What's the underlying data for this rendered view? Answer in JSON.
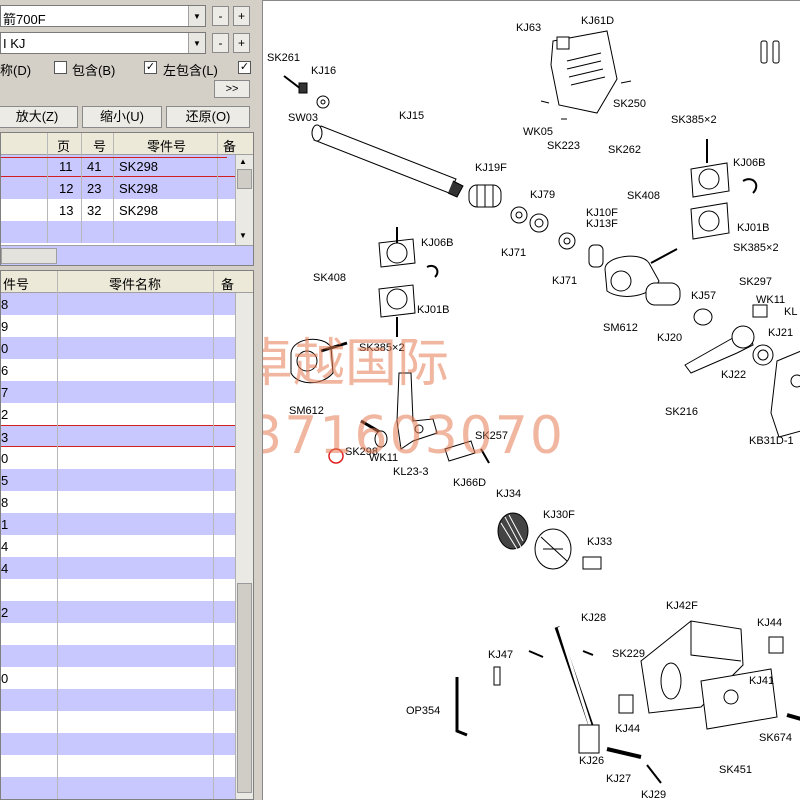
{
  "toolbar": {
    "combo1": "箭700F",
    "combo2": "I KJ",
    "minus": "-",
    "plus": "+",
    "dropdown_glyph": "▼",
    "check1_label": "称(D)",
    "check2_label": "包含(B)",
    "check3_label": "左包含(L)",
    "check2_checked": false,
    "check3_checked": true,
    "check4_checked": true,
    "nav_label": ">>",
    "zoom_in": "放大(Z)",
    "zoom_out": "缩小(U)",
    "restore": "还原(O)"
  },
  "top_table": {
    "headers": [
      "页",
      "号",
      "零件号",
      "备"
    ],
    "rows": [
      {
        "page": "11",
        "num": "41",
        "part": "SK298",
        "selected": true
      },
      {
        "page": "12",
        "num": "23",
        "part": "SK298",
        "selected": true
      },
      {
        "page": "13",
        "num": "32",
        "part": "SK298",
        "selected": false
      }
    ],
    "scroll_up": "▲",
    "scroll_down": "▼"
  },
  "bottom_table": {
    "headers": [
      "件号",
      "零件名称",
      "备"
    ],
    "row_codes": [
      "8",
      "9",
      "0",
      "6",
      "7",
      "2",
      "3",
      "0",
      "5",
      "8",
      "1",
      "4",
      "4",
      "",
      "2",
      "",
      "",
      "0",
      "",
      "",
      "",
      "",
      ""
    ],
    "selected_row_index": 6
  },
  "diagram": {
    "labels": [
      "SK261",
      "KJ16",
      "SW03",
      "KJ15",
      "KJ63",
      "KJ61D",
      "SK250",
      "WK05",
      "SK223",
      "SK262",
      "SK385×2",
      "KJ06B",
      "KJ19F",
      "KJ79",
      "SK408",
      "KJ01B",
      "SK385×2",
      "KJ10F",
      "KJ13F",
      "KJ71",
      "KJ71",
      "KJ06B",
      "SK408",
      "KJ01B",
      "SK297",
      "WK11",
      "KL",
      "KJ57",
      "SM612",
      "KJ20",
      "KJ21",
      "SK385×2",
      "KJ22",
      "SM612",
      "SK216",
      "KB31D-1",
      "SK257",
      "SK298",
      "WK11",
      "KL23-3",
      "KJ66D",
      "KJ34",
      "KJ30F",
      "KJ33",
      "KJ28",
      "KJ42F",
      "KJ44",
      "SK229",
      "KJ47",
      "KJ41",
      "OP354",
      "KJ44",
      "SK674",
      "KJ26",
      "SK451",
      "KJ27",
      "KJ29"
    ],
    "watermark_line1": "卓越国际",
    "watermark_line2": "13371603070",
    "highlight_color": "#e02020",
    "selection_color": "#c8c8ff"
  }
}
